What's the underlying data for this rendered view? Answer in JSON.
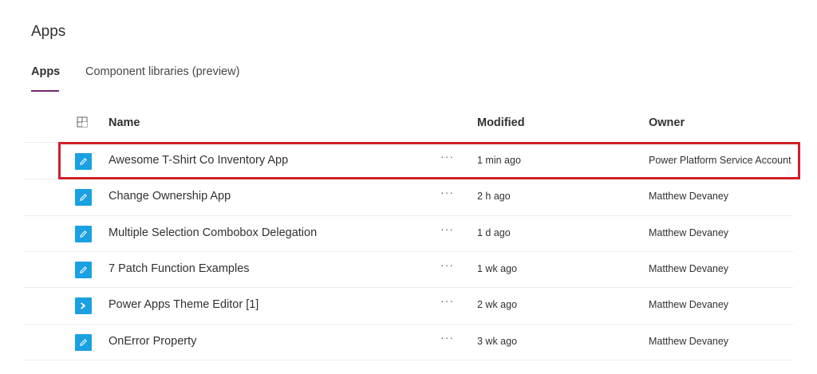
{
  "page": {
    "title": "Apps"
  },
  "tabs": [
    {
      "label": "Apps",
      "active": true
    },
    {
      "label": "Component libraries (preview)",
      "active": false
    }
  ],
  "table": {
    "headers": {
      "name": "Name",
      "modified": "Modified",
      "owner": "Owner"
    },
    "more_glyph": "···",
    "rows": [
      {
        "name": "Awesome T-Shirt Co Inventory App",
        "modified": "1 min ago",
        "owner": "Power Platform Service Account",
        "icon": "canvas-app-icon"
      },
      {
        "name": "Change Ownership App",
        "modified": "2 h ago",
        "owner": "Matthew Devaney",
        "icon": "canvas-app-icon"
      },
      {
        "name": "Multiple Selection Combobox Delegation",
        "modified": "1 d ago",
        "owner": "Matthew Devaney",
        "icon": "canvas-app-icon"
      },
      {
        "name": "7 Patch Function Examples",
        "modified": "1 wk ago",
        "owner": "Matthew Devaney",
        "icon": "canvas-app-icon"
      },
      {
        "name": "Power Apps Theme Editor [1]",
        "modified": "2 wk ago",
        "owner": "Matthew Devaney",
        "icon": "model-app-icon"
      },
      {
        "name": "OnError Property",
        "modified": "3 wk ago",
        "owner": "Matthew Devaney",
        "icon": "canvas-app-icon"
      }
    ]
  },
  "colors": {
    "accent": "#742774",
    "app_icon": "#1ba1e2",
    "highlight": "#d0202a",
    "divider": "#edebe9"
  }
}
